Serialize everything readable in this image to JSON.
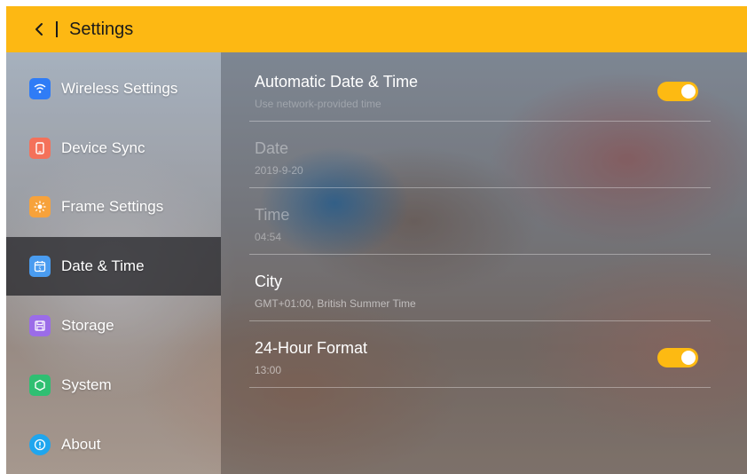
{
  "header": {
    "title": "Settings",
    "back_icon": "chevron-left-icon",
    "color": "#FDB813"
  },
  "sidebar": {
    "items": [
      {
        "label": "Wireless Settings",
        "icon": "wifi-icon",
        "icon_color": "#2F7CF6"
      },
      {
        "label": "Device Sync",
        "icon": "phone-icon",
        "icon_color": "#F4715A"
      },
      {
        "label": "Frame Settings",
        "icon": "sun-icon",
        "icon_color": "#F7A23B"
      },
      {
        "label": "Date & Time",
        "icon": "calendar-icon",
        "icon_color": "#4A9CF0",
        "active": true
      },
      {
        "label": "Storage",
        "icon": "floppy-icon",
        "icon_color": "#9B6CE8"
      },
      {
        "label": "System",
        "icon": "hexagon-icon",
        "icon_color": "#2FBF72"
      },
      {
        "label": "About",
        "icon": "info-icon",
        "icon_color": "#1FA6EE"
      }
    ]
  },
  "settings": {
    "automatic": {
      "title": "Automatic Date & Time",
      "subtitle": "Use network-provided time",
      "enabled": true
    },
    "date": {
      "title": "Date",
      "value": "2019-9-20"
    },
    "time": {
      "title": "Time",
      "value": "04:54"
    },
    "city": {
      "title": "City",
      "value": "GMT+01:00, British Summer Time"
    },
    "format24": {
      "title": "24-Hour Format",
      "value": "13:00",
      "enabled": true
    }
  },
  "accent_color": "#FDBA12"
}
